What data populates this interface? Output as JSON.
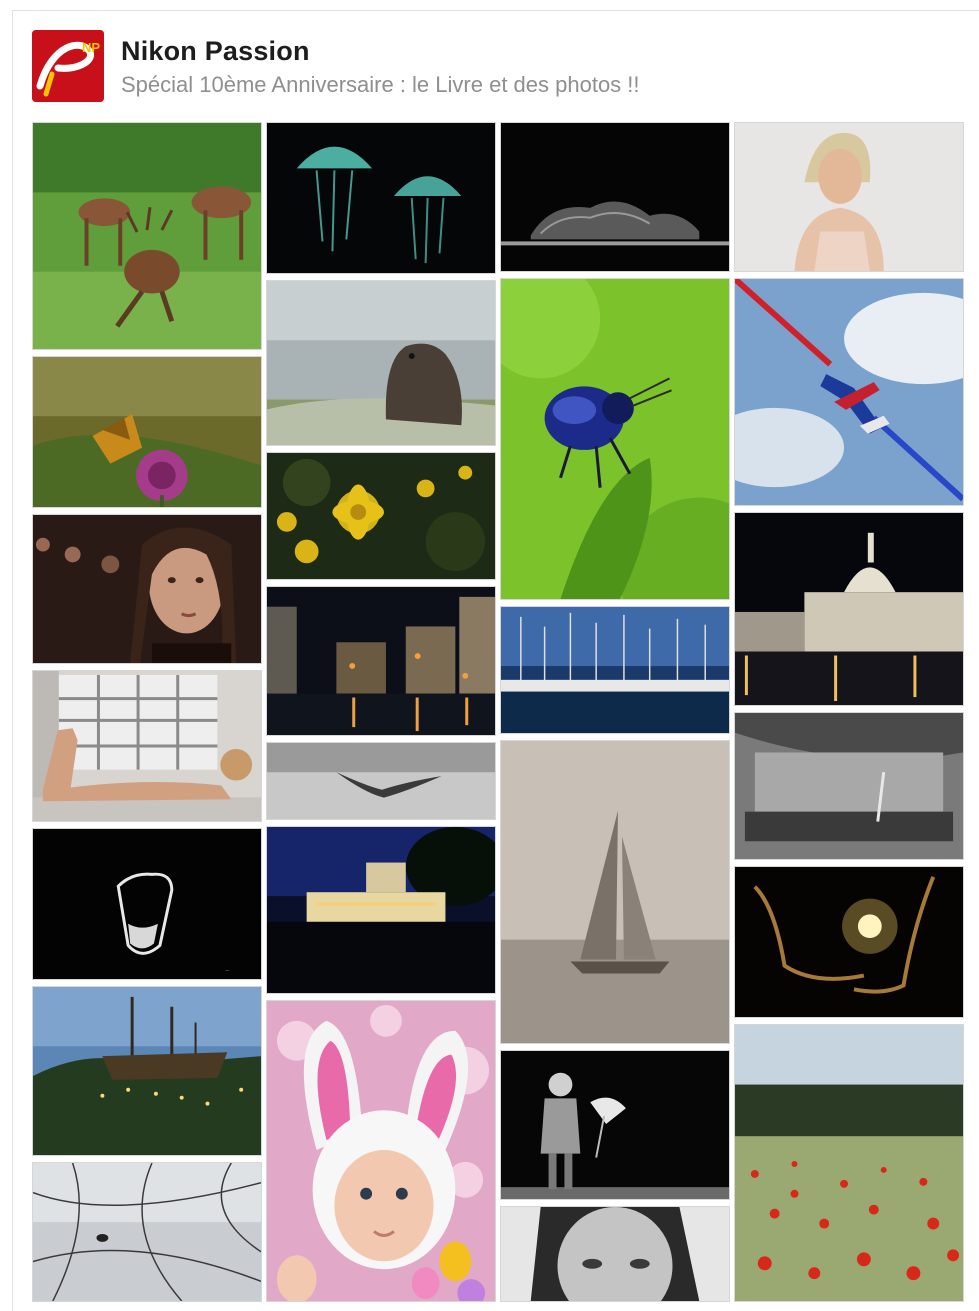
{
  "page": {
    "title": "Nikon Passion",
    "subtitle": "Spécial 10ème Anniversaire : le Livre et des photos !!",
    "logo_icon": "nikon-passion-logo",
    "logo_text": "NP",
    "brand_color": "#c8101a"
  },
  "photos": [
    {
      "subject": "deer"
    },
    {
      "subject": "jellyfish"
    },
    {
      "subject": "reclining-figure-dark"
    },
    {
      "subject": "woman-portrait-light"
    },
    {
      "subject": "butterfly-on-flower"
    },
    {
      "subject": "marmot"
    },
    {
      "subject": "blue-beetle"
    },
    {
      "subject": "aerobatic-jet"
    },
    {
      "subject": "woman-portrait-bokeh"
    },
    {
      "subject": "yellow-flower"
    },
    {
      "subject": "night-canal"
    },
    {
      "subject": "basilica-night"
    },
    {
      "subject": "woman-by-window"
    },
    {
      "subject": "marina-boats"
    },
    {
      "subject": "bird-in-flight"
    },
    {
      "subject": "fountain-bw"
    },
    {
      "subject": "night-pavilion"
    },
    {
      "subject": "sailboat-fog"
    },
    {
      "subject": "hands-with-light"
    },
    {
      "subject": "glass-dark"
    },
    {
      "subject": "pirate-ship"
    },
    {
      "subject": "baby-bunny-hat"
    },
    {
      "subject": "child-umbrella-bw"
    },
    {
      "subject": "poppy-field"
    },
    {
      "subject": "bird-branches-winter"
    },
    {
      "subject": "woman-face-bw"
    }
  ]
}
